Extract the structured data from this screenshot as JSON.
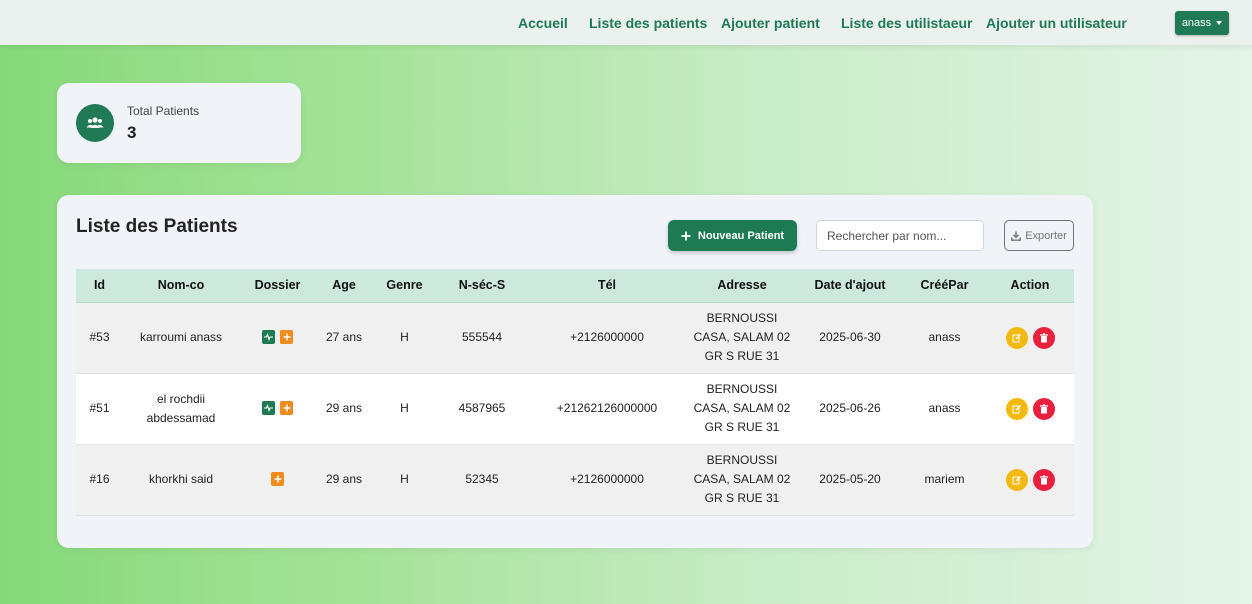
{
  "navbar": {
    "links": [
      "Accueil",
      "Liste des patients",
      "Ajouter patient",
      "Liste des utilistaeur",
      "Ajouter un utilisateur"
    ],
    "user": "anass"
  },
  "stats": {
    "label": "Total Patients",
    "value": "3",
    "icon": "users-icon"
  },
  "patients_panel": {
    "title": "Liste des Patients",
    "new_button": "Nouveau Patient",
    "search_placeholder": "Rechercher par nom...",
    "export_button": "Exporter",
    "columns": [
      "Id",
      "Nom-co",
      "Dossier",
      "Age",
      "Genre",
      "N-séc-S",
      "Tél",
      "Adresse",
      "Date d'ajout",
      "CrééPar",
      "Action"
    ],
    "rows": [
      {
        "id": "#53",
        "name": "karroumi anass",
        "dossier": [
          "file-medical-icon",
          "plus-square-icon"
        ],
        "age": "27 ans",
        "genre": "H",
        "nsec": "555544",
        "tel": "+2126000000",
        "adresse": "BERNOUSSI CASA, SALAM 02 GR S RUE 31",
        "date": "2025-06-30",
        "creepar": "anass"
      },
      {
        "id": "#51",
        "name": "el rochdii abdessamad",
        "dossier": [
          "file-medical-icon",
          "plus-square-icon"
        ],
        "age": "29 ans",
        "genre": "H",
        "nsec": "4587965",
        "tel": "+21262126000000",
        "adresse": "BERNOUSSI CASA, SALAM 02 GR S RUE 31",
        "date": "2025-06-26",
        "creepar": "anass"
      },
      {
        "id": "#16",
        "name": "khorkhi said",
        "dossier": [
          "plus-square-icon"
        ],
        "age": "29 ans",
        "genre": "H",
        "nsec": "52345",
        "tel": "+2126000000",
        "adresse": "BERNOUSSI CASA, SALAM 02 GR S RUE 31",
        "date": "2025-05-20",
        "creepar": "mariem"
      }
    ]
  },
  "colors": {
    "brand": "#1f7a55",
    "edit": "#f4b90e",
    "delete": "#e8203e",
    "add_file": "#f08c1c"
  }
}
